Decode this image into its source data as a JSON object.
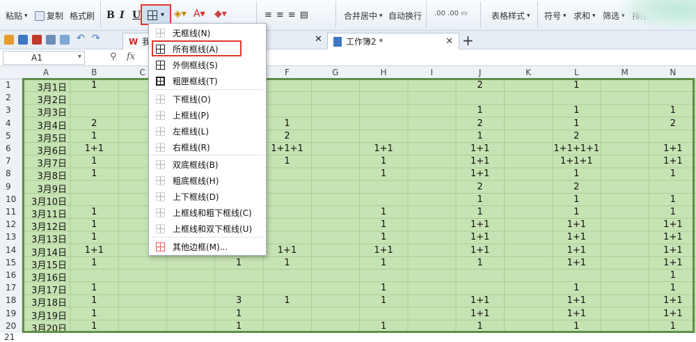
{
  "ribbon": {
    "paste_label": "粘贴",
    "copy_label": "复制",
    "format_painter_label": "格式刷",
    "bold": "B",
    "italic": "I",
    "underline": "U",
    "merge_center_label": "合并居中",
    "auto_wrap_label": "自动换行",
    "table_style_label": "表格样式",
    "symbol_label": "符号",
    "sum_label": "求和",
    "filter_label": "筛选",
    "sort_label": "排序",
    "format_label": "格式"
  },
  "tabs": [
    {
      "label": "我"
    },
    {
      "label": "工作簿2 *"
    }
  ],
  "formula_bar": {
    "name_box": "A1",
    "fx": "fx"
  },
  "columns": [
    "A",
    "B",
    "C",
    "D",
    "E",
    "F",
    "G",
    "H",
    "I",
    "J",
    "K",
    "L",
    "M",
    "N"
  ],
  "rows": [
    "1",
    "2",
    "3",
    "4",
    "5",
    "6",
    "7",
    "8",
    "9",
    "10",
    "11",
    "12",
    "13",
    "14",
    "15",
    "16",
    "17",
    "18",
    "19",
    "20",
    "21"
  ],
  "cells": {
    "A": [
      "3月1日",
      "3月2日",
      "3月3日",
      "3月4日",
      "3月5日",
      "3月6日",
      "3月7日",
      "3月8日",
      "3月9日",
      "3月10日",
      "3月11日",
      "3月12日",
      "3月13日",
      "3月14日",
      "3月15日",
      "3月16日",
      "3月17日",
      "3月18日",
      "3月19日",
      "3月20日"
    ],
    "B": [
      "1",
      "",
      "",
      "2",
      "1",
      "1+1",
      "1",
      "1",
      "",
      "",
      "1",
      "1",
      "1",
      "1+1",
      "1",
      "",
      "1",
      "1",
      "1",
      "1"
    ],
    "E": [
      "",
      "",
      "",
      "",
      "",
      "",
      "",
      "",
      "",
      "",
      "",
      "",
      "",
      "",
      "1",
      "",
      "",
      "3",
      "1",
      "1"
    ],
    "F": [
      "",
      "",
      "",
      "1",
      "2",
      "1+1+1",
      "1",
      "",
      "",
      "",
      "",
      "",
      "",
      "1+1",
      "1",
      "",
      "",
      "1",
      "",
      ""
    ],
    "H": [
      "",
      "",
      "",
      "",
      "",
      "1+1",
      "1",
      "1",
      "",
      "",
      "1",
      "1",
      "1",
      "1+1",
      "1",
      "",
      "1",
      "1",
      "",
      "1"
    ],
    "J": [
      "2",
      "",
      "1",
      "2",
      "1",
      "1+1",
      "1+1",
      "1+1",
      "2",
      "1",
      "1",
      "1+1",
      "1+1",
      "1+1",
      "1",
      "",
      "",
      "1+1",
      "1+1",
      "1"
    ],
    "L": [
      "1",
      "",
      "1",
      "1",
      "2",
      "1+1+1+1",
      "1+1+1",
      "1",
      "2",
      "1",
      "1",
      "1+1",
      "1+1",
      "1+1",
      "1+1",
      "",
      "1",
      "1+1",
      "1+1",
      "1"
    ],
    "N": [
      "",
      "",
      "1",
      "2",
      "",
      "1+1",
      "1+1",
      "1",
      "",
      "1",
      "1",
      "1+1",
      "1+1",
      "1+1",
      "1+1",
      "1",
      "1",
      "1+1",
      "1+1",
      "1"
    ]
  },
  "border_menu": {
    "items": [
      {
        "label": "无框线(N)",
        "icon": "no-border-icon"
      },
      {
        "label": "所有框线(A)",
        "icon": "all-borders-icon"
      },
      {
        "label": "外侧框线(S)",
        "icon": "outside-borders-icon"
      },
      {
        "label": "粗匣框线(T)",
        "icon": "thick-box-border-icon"
      },
      {
        "label": "下框线(O)",
        "icon": "bottom-border-icon"
      },
      {
        "label": "上框线(P)",
        "icon": "top-border-icon"
      },
      {
        "label": "左框线(L)",
        "icon": "left-border-icon"
      },
      {
        "label": "右框线(R)",
        "icon": "right-border-icon"
      },
      {
        "label": "双底框线(B)",
        "icon": "double-bottom-border-icon"
      },
      {
        "label": "粗底框线(H)",
        "icon": "thick-bottom-border-icon"
      },
      {
        "label": "上下框线(D)",
        "icon": "top-bottom-border-icon"
      },
      {
        "label": "上框线和粗下框线(C)",
        "icon": "top-thick-bottom-border-icon"
      },
      {
        "label": "上框线和双下框线(U)",
        "icon": "top-double-bottom-border-icon"
      },
      {
        "label": "其他边框(M)...",
        "icon": "more-borders-icon"
      }
    ]
  },
  "colors": {
    "selection_fill": "#c6e3b3",
    "selection_border": "#5e8f47",
    "highlight_red": "#e0382d"
  }
}
